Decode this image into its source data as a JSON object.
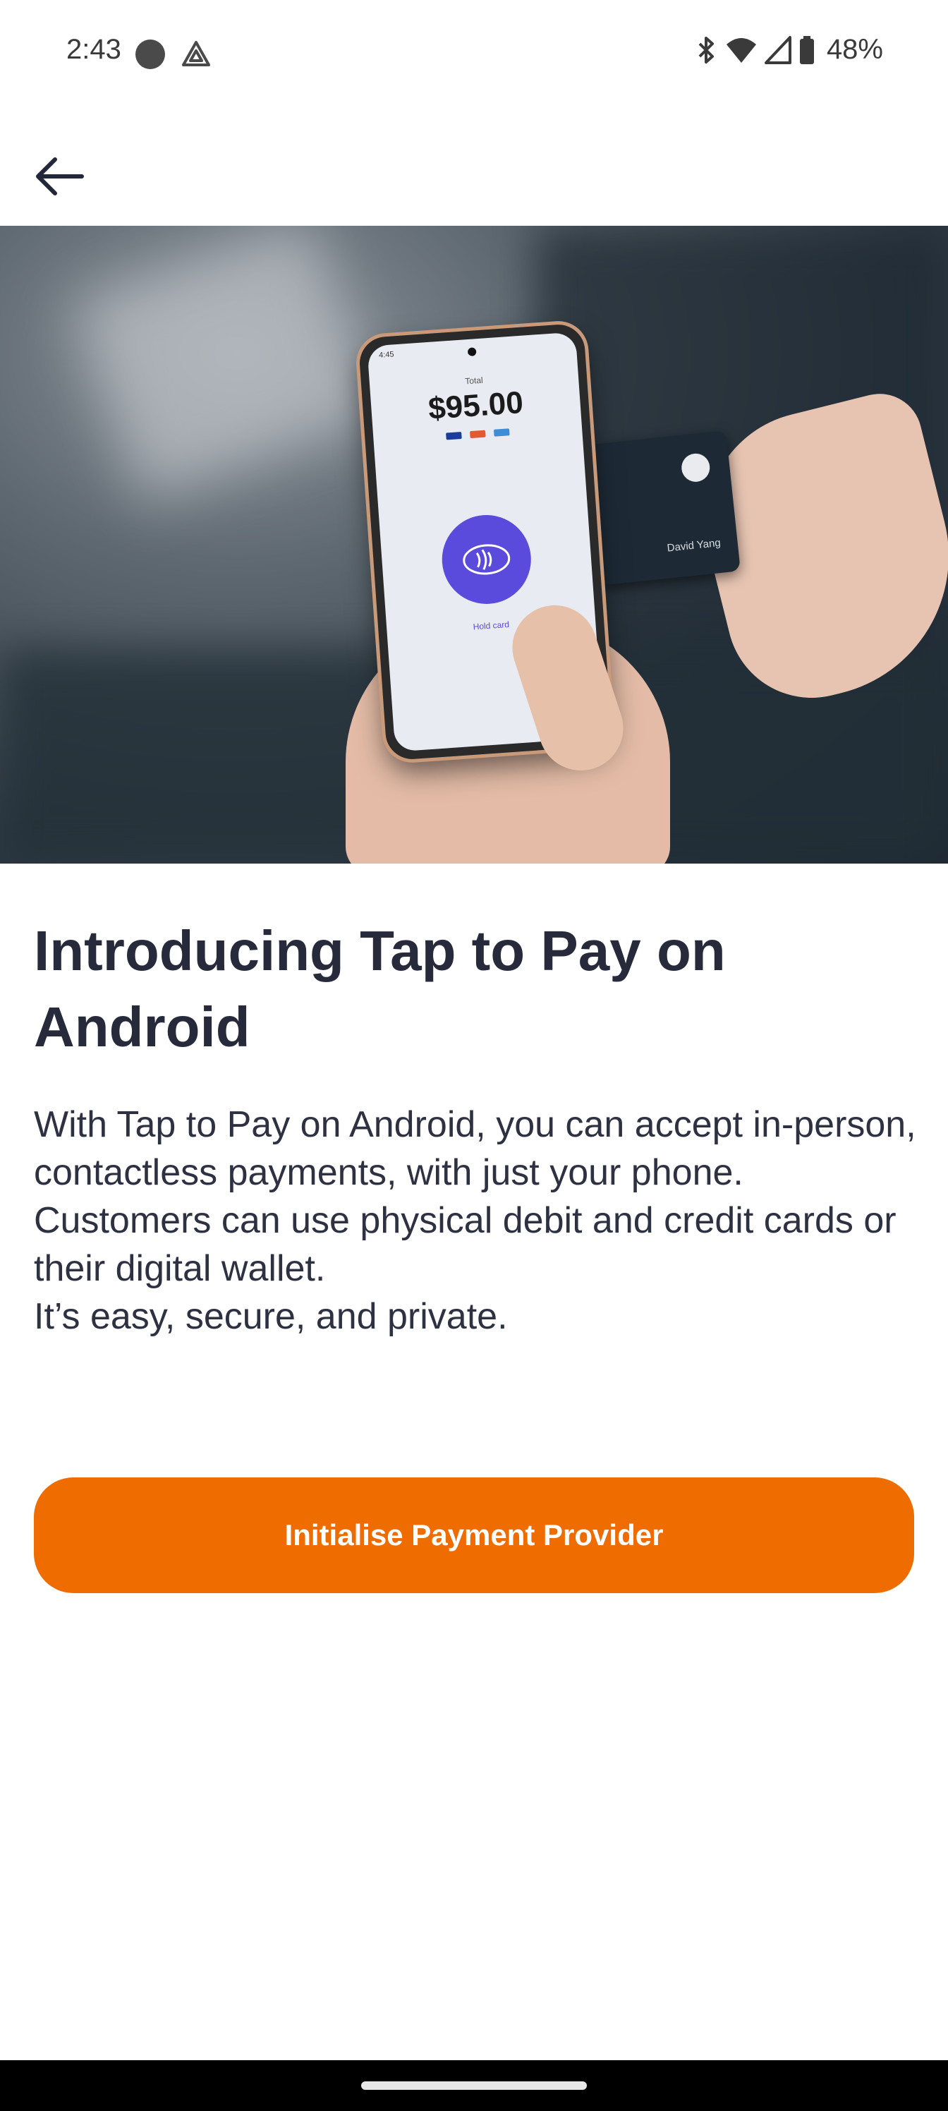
{
  "status_bar": {
    "time": "2:43",
    "battery_percent": "48%",
    "icons": [
      "recording-dot-icon",
      "app-notification-icon",
      "bluetooth-icon",
      "wifi-icon",
      "cell-signal-icon",
      "battery-icon"
    ]
  },
  "app_bar": {
    "back_icon": "arrow-back-icon"
  },
  "hero_image": {
    "phone_screen": {
      "total_label": "Total",
      "amount": "$95.00",
      "hold_card_label": "Hold card"
    },
    "card_name": "David Yang"
  },
  "content": {
    "title": "Introducing Tap to Pay on Android",
    "description": "With Tap to Pay on Android, you can accept in-person, contactless payments, with just your phone. Customers can use physical debit and credit cards or their digital wallet.\nIt’s easy, secure, and private."
  },
  "actions": {
    "primary_button_label": "Initialise Payment Provider"
  },
  "colors": {
    "accent": "#ef6c00",
    "title_text": "#262a3b",
    "body_text": "#2d3142",
    "background": "#ffffff",
    "nfc_purple": "#5b4bdc"
  }
}
